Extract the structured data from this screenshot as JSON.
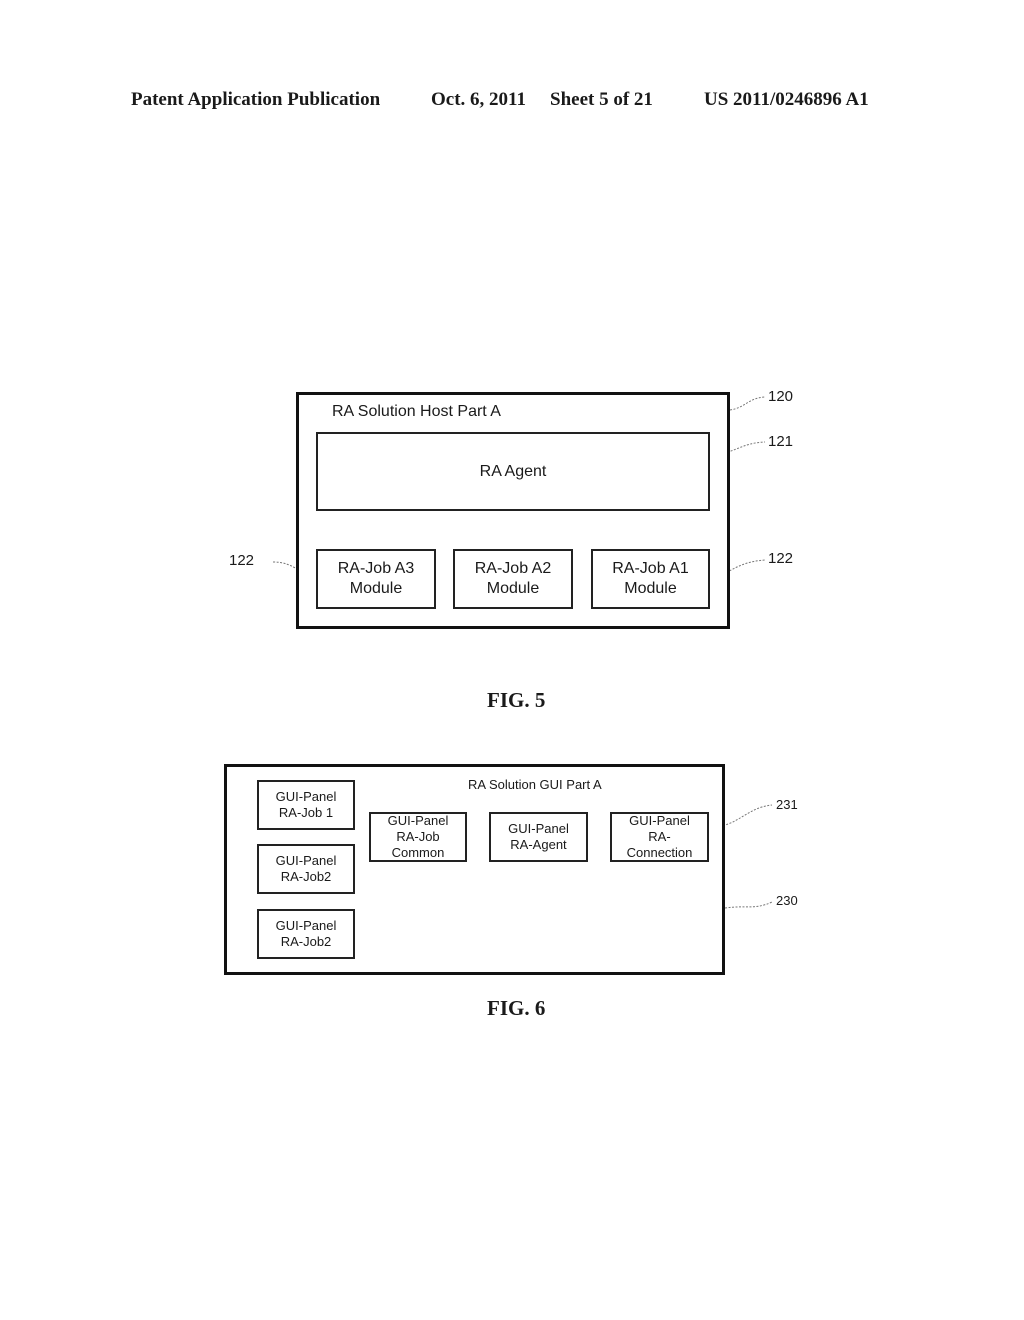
{
  "header": {
    "publication_type": "Patent Application Publication",
    "date": "Oct. 6, 2011",
    "sheet": "Sheet 5 of 21",
    "patent_number": "US 2011/0246896 A1"
  },
  "fig5": {
    "caption": "FIG. 5",
    "host": {
      "title": "RA Solution Host Part A",
      "ref": "120"
    },
    "agent": {
      "label": "RA Agent",
      "ref": "121"
    },
    "modules": [
      {
        "line1": "RA-Job A3",
        "line2": "Module"
      },
      {
        "line1": "RA-Job A2",
        "line2": "Module"
      },
      {
        "line1": "RA-Job A1",
        "line2": "Module"
      }
    ],
    "module_ref_left": "122",
    "module_ref_right": "122"
  },
  "fig6": {
    "caption": "FIG. 6",
    "gui": {
      "title": "RA Solution GUI Part A",
      "ref": "230"
    },
    "left_panels": [
      {
        "line1": "GUI-Panel",
        "line2": "RA-Job 1"
      },
      {
        "line1": "GUI-Panel",
        "line2": "RA-Job2"
      },
      {
        "line1": "GUI-Panel",
        "line2": "RA-Job2"
      }
    ],
    "top_panels": [
      {
        "line1": "GUI-Panel",
        "line2": "RA-Job",
        "line3": "Common"
      },
      {
        "line1": "GUI-Panel",
        "line2": "RA-Agent",
        "line3": ""
      },
      {
        "line1": "GUI-Panel",
        "line2": "RA-",
        "line3": "Connection"
      }
    ],
    "panel_ref": "231"
  }
}
